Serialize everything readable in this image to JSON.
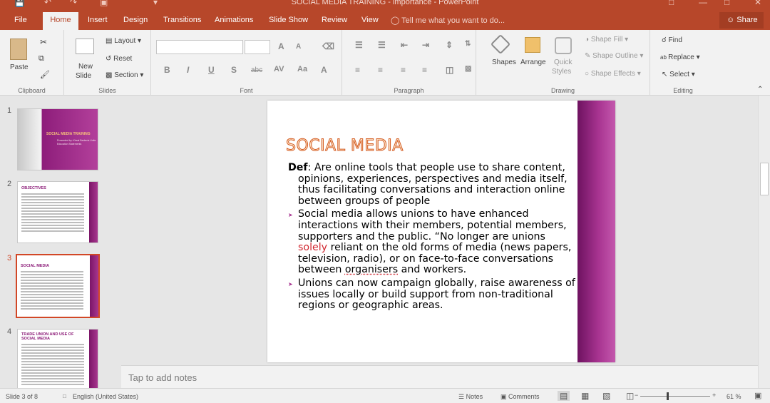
{
  "titlebar": {
    "title": "SOCIAL MEDIA TRAINING - importance - PowerPoint"
  },
  "tabs": [
    {
      "label": "File"
    },
    {
      "label": "Home"
    },
    {
      "label": "Insert"
    },
    {
      "label": "Design"
    },
    {
      "label": "Transitions"
    },
    {
      "label": "Animations"
    },
    {
      "label": "Slide Show"
    },
    {
      "label": "Review"
    },
    {
      "label": "View"
    }
  ],
  "tellme": "Tell me what you want to do...",
  "share": "Share",
  "ribbon": {
    "clipboard": {
      "paste": "Paste",
      "label": "Clipboard"
    },
    "slides": {
      "new_slide_1": "New",
      "new_slide_2": "Slide",
      "layout": "Layout",
      "reset": "Reset",
      "section": "Section",
      "label": "Slides"
    },
    "font": {
      "label": "Font",
      "bold": "B",
      "italic": "I",
      "underline": "U",
      "shadow": "S",
      "strike": "abc",
      "spacing": "AV",
      "case": "Aa",
      "color": "A",
      "grow": "A",
      "shrink": "A"
    },
    "paragraph": {
      "label": "Paragraph"
    },
    "drawing": {
      "shapes": "Shapes",
      "arrange": "Arrange",
      "quick_styles_1": "Quick",
      "quick_styles_2": "Styles",
      "shape_fill": "Shape Fill",
      "shape_outline": "Shape Outline",
      "shape_effects": "Shape Effects",
      "label": "Drawing"
    },
    "editing": {
      "find": "Find",
      "replace": "Replace",
      "select": "Select",
      "label": "Editing"
    }
  },
  "thumbnails": [
    {
      "num": "1",
      "title": "SOCIAL MEDIA TRAINING",
      "subtitle": "Presented by: Kirsal Barberis Unite Education Statements"
    },
    {
      "num": "2",
      "title": "OBJECTIVES"
    },
    {
      "num": "3",
      "title": "SOCIAL MEDIA"
    },
    {
      "num": "4",
      "title": "TRADE UNION AND USE OF SOCIAL MEDIA"
    }
  ],
  "slide": {
    "title": "SOCIAL MEDIA",
    "def_label": "Def",
    "def_text": ": Are online tools that people use to share content, opinions, experiences, perspectives and media itself, thus facilitating conversations and interaction online between groups of people",
    "p2_a": "Social media  allows unions to have enhanced interactions with their members, potential members, supporters and the public.  “No longer are unions ",
    "p2_hl": "solely",
    "p2_b": " reliant on the old forms of media (news papers, television, radio), or on face-to-face conversations between ",
    "p2_sq": "organisers",
    "p2_c": " and workers.",
    "p3": "Unions can now campaign globally, raise awareness of issues locally or build support from non-traditional regions or geographic areas."
  },
  "notes_placeholder": "Tap to add notes",
  "status": {
    "slide_count": "Slide 3 of 8",
    "language": "English (United States)",
    "notes": "Notes",
    "comments": "Comments",
    "zoom": "61 %"
  },
  "colors": {
    "accent": "#b7472a",
    "slide_bar": "#a73390"
  }
}
